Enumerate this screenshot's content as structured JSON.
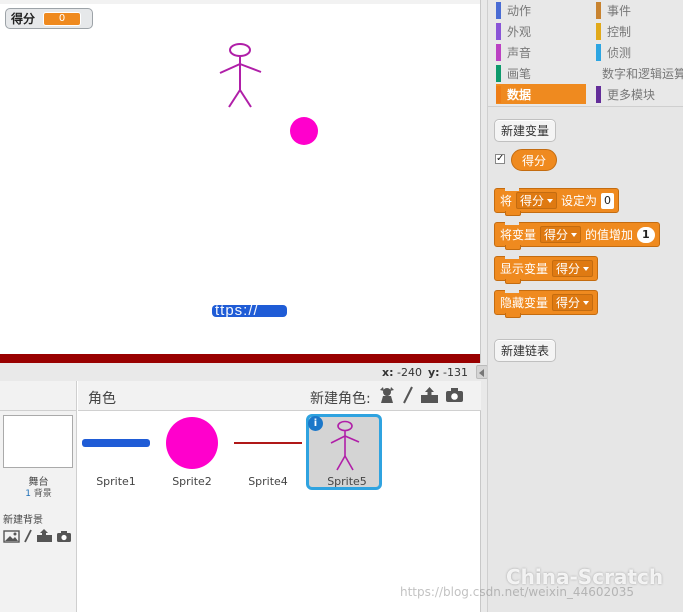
{
  "stage": {
    "variable_monitor": {
      "label": "得分",
      "value": "0"
    },
    "bar_text": "ttps://"
  },
  "coords": {
    "x_label": "x:",
    "x_value": "-240",
    "y_label": "y:",
    "y_value": "-131"
  },
  "sprite_pane": {
    "header_title": "角色",
    "new_sprite_label": "新建角色:",
    "stage": {
      "title": "舞台",
      "bg_count": "1",
      "bg_label": "背景",
      "new_bg_label": "新建背景"
    },
    "sprites": [
      {
        "name": "Sprite1",
        "kind": "blue-bar"
      },
      {
        "name": "Sprite2",
        "kind": "magenta-ball"
      },
      {
        "name": "Sprite4",
        "kind": "red-line"
      },
      {
        "name": "Sprite5",
        "kind": "stick-figure",
        "selected": true
      }
    ],
    "info_icon": "i"
  },
  "palette": {
    "categories": [
      {
        "label": "动作",
        "color": "#4a6cd4"
      },
      {
        "label": "事件",
        "color": "#c88330"
      },
      {
        "label": "外观",
        "color": "#8a55d7"
      },
      {
        "label": "控制",
        "color": "#e1a91a"
      },
      {
        "label": "声音",
        "color": "#bb42c3"
      },
      {
        "label": "侦测",
        "color": "#2ca5e2"
      },
      {
        "label": "画笔",
        "color": "#0e9a6c"
      },
      {
        "label": "数字和逻辑运算",
        "color": "#5cb712"
      },
      {
        "label": "数据",
        "color": "#ee7d16",
        "active": true
      },
      {
        "label": "更多模块",
        "color": "#632d99"
      }
    ],
    "make_variable": "新建变量",
    "variable_reporter": "得分",
    "variable_checked": "✓",
    "blocks": {
      "set": {
        "prefix": "将",
        "var": "得分",
        "middle": "设定为",
        "value": "0"
      },
      "change": {
        "prefix": "将变量",
        "var": "得分",
        "middle": "的值增加",
        "value": "1"
      },
      "show": {
        "prefix": "显示变量",
        "var": "得分"
      },
      "hide": {
        "prefix": "隐藏变量",
        "var": "得分"
      }
    },
    "make_list": "新建链表"
  },
  "watermark": {
    "url": "https://blog.csdn.net/weixin_44602035",
    "logo": "China-Scratch"
  },
  "colors": {
    "accent": "#ef8a1f",
    "selected_border": "#2fa3e0",
    "floor": "#990000",
    "ball": "#ff00cc",
    "bar": "#1f5cd6"
  }
}
